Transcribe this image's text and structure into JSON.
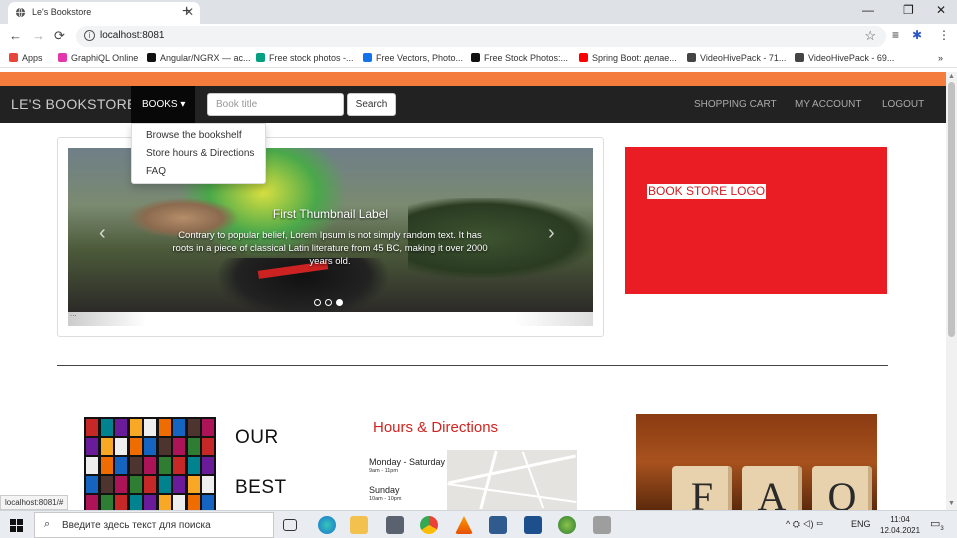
{
  "browser": {
    "tab_title": "Le's Bookstore",
    "tab_close": "✕",
    "new_tab": "+",
    "window_controls": [
      "—",
      "❐",
      "✕"
    ],
    "back": "←",
    "forward": "→",
    "reload": "⟳",
    "url": "localhost:8081",
    "star": "☆"
  },
  "bookmarks": [
    {
      "label": "Apps",
      "color": "#e8453c"
    },
    {
      "label": "GraphiQL Online",
      "color": "#e535ab"
    },
    {
      "label": "Angular/NGRX — ас...",
      "color": "#111111"
    },
    {
      "label": "Free stock photos -...",
      "color": "#05a081"
    },
    {
      "label": "Free Vectors, Photo...",
      "color": "#1273eb"
    },
    {
      "label": "Free Stock Photos:...",
      "color": "#111111"
    },
    {
      "label": "Spring Boot: делае...",
      "color": "#ff0000"
    },
    {
      "label": "VideoHivePack - 71...",
      "color": "#444444"
    },
    {
      "label": "VideoHivePack - 69...",
      "color": "#444444"
    }
  ],
  "bookmarks_more": "»",
  "navbar": {
    "brand": "LE'S BOOKSTORE",
    "books": "BOOKS ▾",
    "search_placeholder": "Book title",
    "search_button": "Search",
    "shopping_cart": "SHOPPING CART",
    "my_account": "MY ACCOUNT",
    "logout": "LOGOUT"
  },
  "books_menu": [
    "Browse the bookshelf",
    "Store hours & Directions",
    "FAQ"
  ],
  "carousel": {
    "title": "First Thumbnail Label",
    "text": "Contrary to popular belief, Lorem Ipsum is not simply random text. It has roots in a piece of classical Latin literature from 45 BC, making it over 2000 years old.",
    "prev": "‹",
    "next": "›",
    "slides_count": 3,
    "active_index": 2,
    "footer_dots": "..."
  },
  "logo_text": "BOOK STORE LOGO",
  "section": {
    "our": "OUR",
    "best": "BEST",
    "hours_title": "Hours & Directions",
    "weekdays": "Monday - Saturday",
    "weekdays_time": "9am - 11pm",
    "sunday": "Sunday",
    "sunday_time": "10am - 10pm",
    "faq_letters": [
      "F",
      "A",
      "Q"
    ]
  },
  "status_url": "localhost:8081/#",
  "taskbar": {
    "search_placeholder": "Введите здесь текст для поиска",
    "lang": "ENG",
    "time": "11:04",
    "date": "12.04.2021",
    "tray_glyphs": "^  ⛭  ◁)  ▭",
    "notification_count": "3"
  }
}
